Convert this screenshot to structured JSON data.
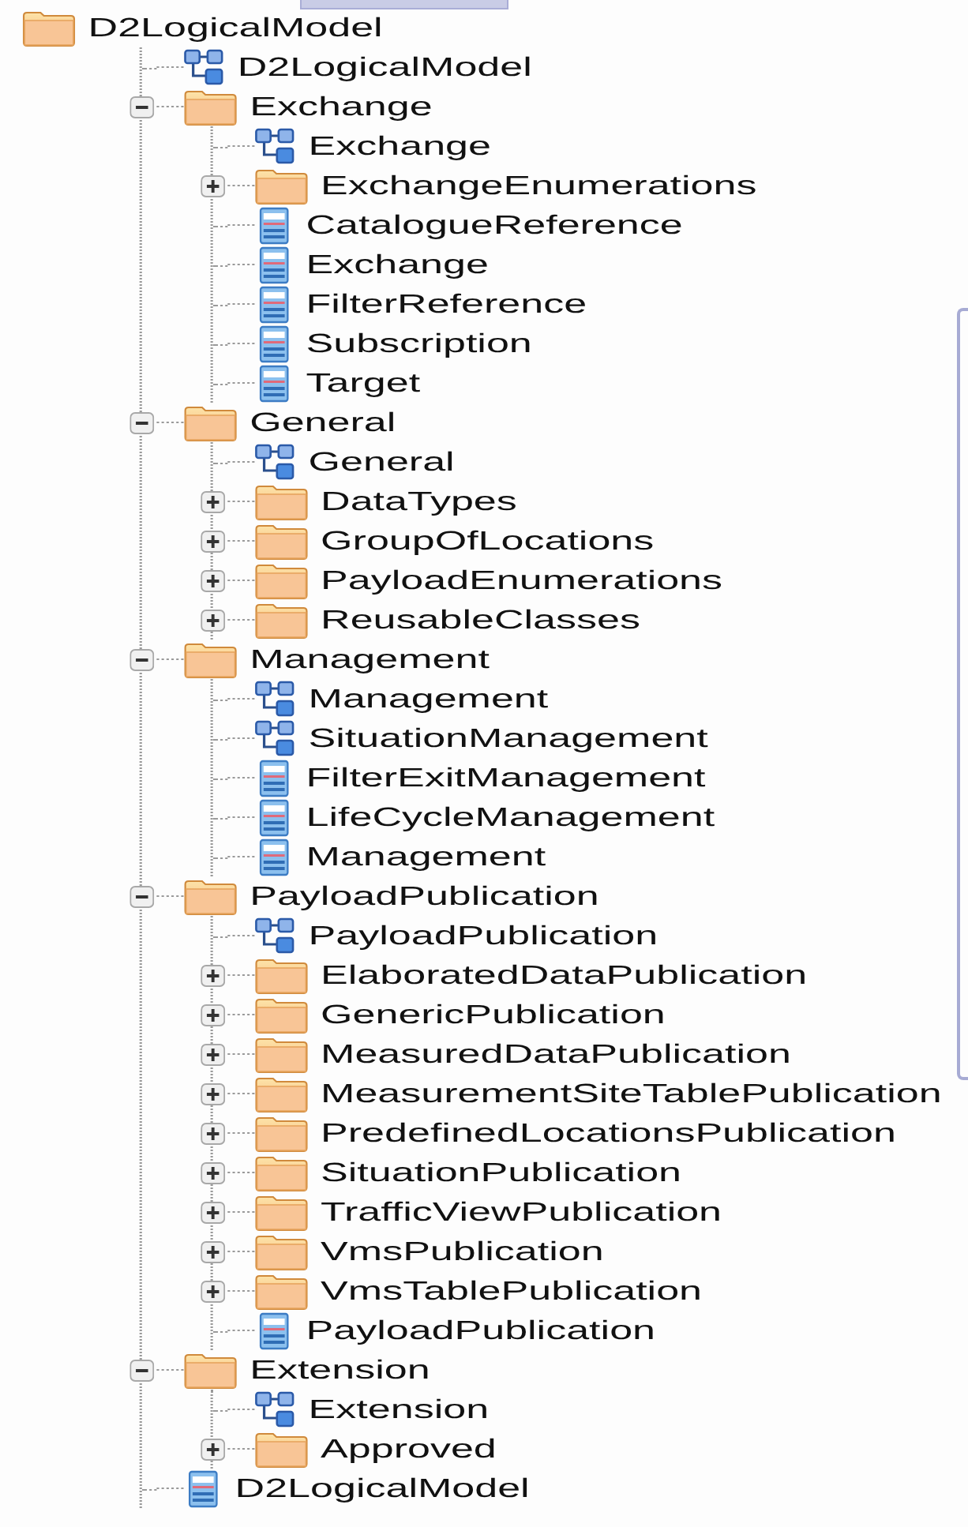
{
  "tree": {
    "label": "D2LogicalModel",
    "kind": "folder",
    "children": [
      {
        "label": "D2LogicalModel",
        "kind": "diagram"
      },
      {
        "label": "Exchange",
        "kind": "folder",
        "expanded": true,
        "children": [
          {
            "label": "Exchange",
            "kind": "diagram"
          },
          {
            "label": "ExchangeEnumerations",
            "kind": "folder",
            "expanded": false
          },
          {
            "label": "CatalogueReference",
            "kind": "class"
          },
          {
            "label": "Exchange",
            "kind": "class"
          },
          {
            "label": "FilterReference",
            "kind": "class"
          },
          {
            "label": "Subscription",
            "kind": "class"
          },
          {
            "label": "Target",
            "kind": "class"
          }
        ]
      },
      {
        "label": "General",
        "kind": "folder",
        "expanded": true,
        "children": [
          {
            "label": "General",
            "kind": "diagram"
          },
          {
            "label": "DataTypes",
            "kind": "folder",
            "expanded": false
          },
          {
            "label": "GroupOfLocations",
            "kind": "folder",
            "expanded": false
          },
          {
            "label": "PayloadEnumerations",
            "kind": "folder",
            "expanded": false
          },
          {
            "label": "ReusableClasses",
            "kind": "folder",
            "expanded": false
          }
        ]
      },
      {
        "label": "Management",
        "kind": "folder",
        "expanded": true,
        "children": [
          {
            "label": "Management",
            "kind": "diagram"
          },
          {
            "label": "SituationManagement",
            "kind": "diagram"
          },
          {
            "label": "FilterExitManagement",
            "kind": "class"
          },
          {
            "label": "LifeCycleManagement",
            "kind": "class"
          },
          {
            "label": "Management",
            "kind": "class"
          }
        ]
      },
      {
        "label": "PayloadPublication",
        "kind": "folder",
        "expanded": true,
        "children": [
          {
            "label": "PayloadPublication",
            "kind": "diagram"
          },
          {
            "label": "ElaboratedDataPublication",
            "kind": "folder",
            "expanded": false
          },
          {
            "label": "GenericPublication",
            "kind": "folder",
            "expanded": false
          },
          {
            "label": "MeasuredDataPublication",
            "kind": "folder",
            "expanded": false
          },
          {
            "label": "MeasurementSiteTablePublication",
            "kind": "folder",
            "expanded": false
          },
          {
            "label": "PredefinedLocationsPublication",
            "kind": "folder",
            "expanded": false
          },
          {
            "label": "SituationPublication",
            "kind": "folder",
            "expanded": false
          },
          {
            "label": "TrafficViewPublication",
            "kind": "folder",
            "expanded": false
          },
          {
            "label": "VmsPublication",
            "kind": "folder",
            "expanded": false
          },
          {
            "label": "VmsTablePublication",
            "kind": "folder",
            "expanded": false
          },
          {
            "label": "PayloadPublication",
            "kind": "class"
          }
        ]
      },
      {
        "label": "Extension",
        "kind": "folder",
        "expanded": true,
        "children": [
          {
            "label": "Extension",
            "kind": "diagram"
          },
          {
            "label": "Approved",
            "kind": "folder",
            "expanded": false
          }
        ]
      },
      {
        "label": "D2LogicalModel",
        "kind": "class"
      }
    ]
  }
}
